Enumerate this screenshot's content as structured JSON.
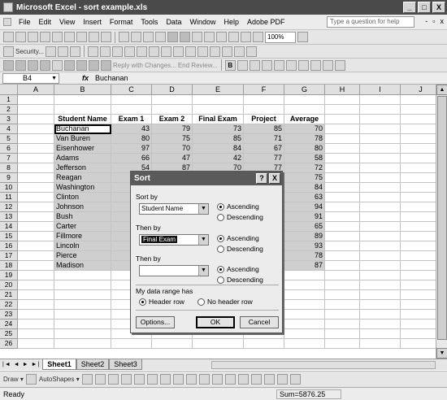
{
  "window": {
    "title": "Microsoft Excel - sort example.xls",
    "min": "_",
    "max": "□",
    "close": "X"
  },
  "menu": {
    "items": [
      "File",
      "Edit",
      "View",
      "Insert",
      "Format",
      "Tools",
      "Data",
      "Window",
      "Help",
      "Adobe PDF"
    ],
    "help_placeholder": "Type a question for help",
    "doc_min": "-",
    "doc_restore": "▫",
    "doc_close": "x"
  },
  "toolbar1": {
    "zoom": "100%"
  },
  "toolbar2": {
    "security": "Security...",
    "reply": "Reply with Changes...",
    "end_review": "End Review..."
  },
  "formula": {
    "cell_ref": "B4",
    "fx": "fx",
    "value": "Buchanan"
  },
  "columns": [
    "A",
    "B",
    "C",
    "D",
    "E",
    "F",
    "G",
    "H",
    "I",
    "J"
  ],
  "rows": [
    "1",
    "2",
    "3",
    "4",
    "5",
    "6",
    "7",
    "8",
    "9",
    "10",
    "11",
    "12",
    "13",
    "14",
    "15",
    "16",
    "17",
    "18",
    "19",
    "20",
    "21",
    "22",
    "23",
    "24",
    "25",
    "26"
  ],
  "sheet": {
    "headers": [
      "Student Name",
      "Exam 1",
      "Exam 2",
      "Final Exam",
      "Project",
      "Average"
    ],
    "data": [
      [
        "Buchanan",
        "43",
        "79",
        "73",
        "85",
        "70"
      ],
      [
        "Van Buren",
        "80",
        "75",
        "85",
        "71",
        "78"
      ],
      [
        "Eisenhower",
        "97",
        "70",
        "84",
        "67",
        "80"
      ],
      [
        "Adams",
        "66",
        "47",
        "42",
        "77",
        "58"
      ],
      [
        "Jefferson",
        "54",
        "87",
        "70",
        "77",
        "72"
      ],
      [
        "Reagan",
        "",
        "",
        "",
        "",
        "75"
      ],
      [
        "Washington",
        "",
        "",
        "",
        "",
        "84"
      ],
      [
        "Clinton",
        "",
        "",
        "",
        "",
        "63"
      ],
      [
        "Johnson",
        "",
        "",
        "",
        "",
        "94"
      ],
      [
        "Bush",
        "",
        "",
        "",
        "",
        "91"
      ],
      [
        "Carter",
        "",
        "",
        "",
        "",
        "65"
      ],
      [
        "Fillmore",
        "",
        "",
        "",
        "",
        "89"
      ],
      [
        "Lincoln",
        "",
        "",
        "",
        "",
        "93"
      ],
      [
        "Pierce",
        "",
        "",
        "",
        "",
        "78"
      ],
      [
        "Madison",
        "",
        "",
        "",
        "",
        "87"
      ]
    ]
  },
  "tabs": {
    "nav": "|◄ ◄ ► ►|",
    "sheets": [
      "Sheet1",
      "Sheet2",
      "Sheet3"
    ]
  },
  "drawbar": {
    "draw": "Draw ▾",
    "autoshapes": "AutoShapes ▾"
  },
  "status": {
    "left": "Ready",
    "sum": "Sum=5876.25"
  },
  "dialog": {
    "title": "Sort",
    "help_btn": "?",
    "close_btn": "X",
    "sort_by_label": "Sort by",
    "sort_by_value": "Student Name",
    "then_by1_label": "Then by",
    "then_by1_value": "Final Exam",
    "then_by2_label": "Then by",
    "then_by2_value": "",
    "ascending": "Ascending",
    "descending": "Descending",
    "range_label": "My data range has",
    "header_row": "Header row",
    "no_header_row": "No header row",
    "options": "Options...",
    "ok": "OK",
    "cancel": "Cancel"
  }
}
